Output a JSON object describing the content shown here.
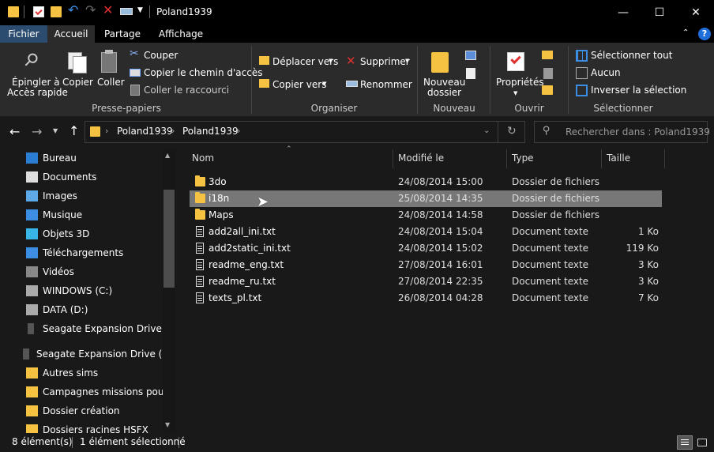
{
  "window": {
    "title": "Poland1939",
    "minimize": "—",
    "maximize": "☐",
    "close": "✕"
  },
  "tabs": [
    "Fichier",
    "Accueil",
    "Partage",
    "Affichage"
  ],
  "ribbon": {
    "pin": "Épingler à",
    "pin2": "Accès rapide",
    "copy": "Copier",
    "paste": "Coller",
    "cut": "Couper",
    "copy_path": "Copier le chemin d'accès",
    "paste_shortcut": "Coller le raccourci",
    "group_clipboard": "Presse-papiers",
    "move_to": "Déplacer vers",
    "copy_to": "Copier vers",
    "delete": "Supprimer",
    "rename": "Renommer",
    "group_organize": "Organiser",
    "new_folder": "Nouveau",
    "new_folder2": "dossier",
    "group_new": "Nouveau",
    "properties": "Propriétés",
    "group_open": "Ouvrir",
    "select_all": "Sélectionner tout",
    "select_none": "Aucun",
    "invert_selection": "Inverser la sélection",
    "group_select": "Sélectionner"
  },
  "address": {
    "crumbs": [
      "Poland1939",
      "Poland1939"
    ],
    "search_placeholder": "Rechercher dans : Poland1939"
  },
  "sidebar": [
    {
      "label": "Bureau",
      "icon": "desktop-icon"
    },
    {
      "label": "Documents",
      "icon": "documents-icon"
    },
    {
      "label": "Images",
      "icon": "pictures-icon"
    },
    {
      "label": "Musique",
      "icon": "music-icon"
    },
    {
      "label": "Objets 3D",
      "icon": "3d-objects-icon"
    },
    {
      "label": "Téléchargements",
      "icon": "downloads-icon"
    },
    {
      "label": "Vidéos",
      "icon": "videos-icon"
    },
    {
      "label": "WINDOWS (C:)",
      "icon": "drive-icon"
    },
    {
      "label": "DATA (D:)",
      "icon": "drive-icon"
    },
    {
      "label": "Seagate Expansion Drive (F:)",
      "icon": "external-drive-icon"
    },
    {
      "label": "Seagate Expansion Drive (F:)",
      "icon": "external-drive-icon"
    },
    {
      "label": "Autres sims",
      "icon": "folder-icon"
    },
    {
      "label": "Campagnes missions pour m",
      "icon": "folder-icon"
    },
    {
      "label": "Dossier création",
      "icon": "folder-icon"
    },
    {
      "label": "Dossiers racines HSFX",
      "icon": "folder-icon"
    }
  ],
  "columns": {
    "name": "Nom",
    "modified": "Modifié le",
    "type": "Type",
    "size": "Taille"
  },
  "files": [
    {
      "name": "3do",
      "modified": "24/08/2014 15:00",
      "type": "Dossier de fichiers",
      "size": "",
      "kind": "folder"
    },
    {
      "name": "i18n",
      "modified": "25/08/2014 14:35",
      "type": "Dossier de fichiers",
      "size": "",
      "kind": "folder"
    },
    {
      "name": "Maps",
      "modified": "24/08/2014 14:58",
      "type": "Dossier de fichiers",
      "size": "",
      "kind": "folder"
    },
    {
      "name": "add2all_ini.txt",
      "modified": "24/08/2014 15:04",
      "type": "Document texte",
      "size": "1 Ko",
      "kind": "text"
    },
    {
      "name": "add2static_ini.txt",
      "modified": "24/08/2014 15:02",
      "type": "Document texte",
      "size": "119 Ko",
      "kind": "text"
    },
    {
      "name": "readme_eng.txt",
      "modified": "27/08/2014 16:01",
      "type": "Document texte",
      "size": "3 Ko",
      "kind": "text"
    },
    {
      "name": "readme_ru.txt",
      "modified": "27/08/2014 22:35",
      "type": "Document texte",
      "size": "3 Ko",
      "kind": "text"
    },
    {
      "name": "texts_pl.txt",
      "modified": "26/08/2014 04:28",
      "type": "Document texte",
      "size": "7 Ko",
      "kind": "text"
    }
  ],
  "status": {
    "count": "8 élément(s)",
    "selected": "1 élément sélectionné"
  }
}
